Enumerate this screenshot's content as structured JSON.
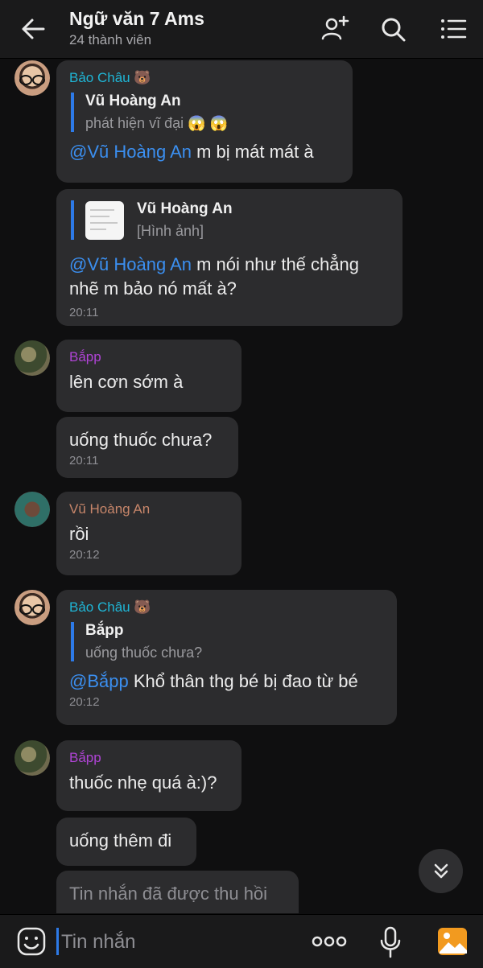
{
  "header": {
    "title": "Ngữ văn 7 Ams",
    "subtitle": "24 thành viên"
  },
  "messages": [
    {
      "sender": "Bảo Châu 🐻",
      "quote_name": "Vũ Hoàng An",
      "quote_text": "phát hiện vĩ đại 😱 😱",
      "mention": "@Vũ Hoàng An",
      "text": " m bị mát mát à"
    },
    {
      "quote_name": "Vũ Hoàng An",
      "quote_text": "[Hình ảnh]",
      "mention": "@Vũ Hoàng An",
      "text": " m nói như thế chẳng nhẽ m bảo nó mất à?",
      "time": "20:11"
    },
    {
      "sender": "Bắpp",
      "text": "lên cơn sớm à"
    },
    {
      "text": "uống thuốc chưa?",
      "time": "20:11"
    },
    {
      "sender": "Vũ Hoàng An",
      "text": "rồi",
      "time": "20:12"
    },
    {
      "sender": "Bảo Châu 🐻",
      "quote_name": "Bắpp",
      "quote_text": "uống thuốc chưa?",
      "mention": "@Bắpp",
      "text": " Khổ thân thg bé bị đao từ bé",
      "time": "20:12"
    },
    {
      "sender": "Bắpp",
      "text": "thuốc nhẹ quá à:)?"
    },
    {
      "text": "uống thêm đi"
    },
    {
      "text": "Tin nhắn đã được thu hồi"
    }
  ],
  "composer": {
    "placeholder": "Tin nhắn"
  },
  "colors": {
    "background": "#0f0f10",
    "bubble": "#2c2c2e",
    "accent": "#2d7ae8",
    "mention": "#3b8ff0",
    "sender_bao": "#1fb6d6",
    "sender_bapp": "#b044d6",
    "sender_vu": "#c7866a"
  },
  "icons": {
    "back": "arrow-left-icon",
    "add_member": "add-person-icon",
    "search": "search-icon",
    "menu": "list-menu-icon",
    "scroll_down": "double-chevron-down-icon",
    "emoji": "emoji-icon",
    "more": "more-dots-icon",
    "mic": "microphone-icon",
    "photo": "photo-icon"
  }
}
